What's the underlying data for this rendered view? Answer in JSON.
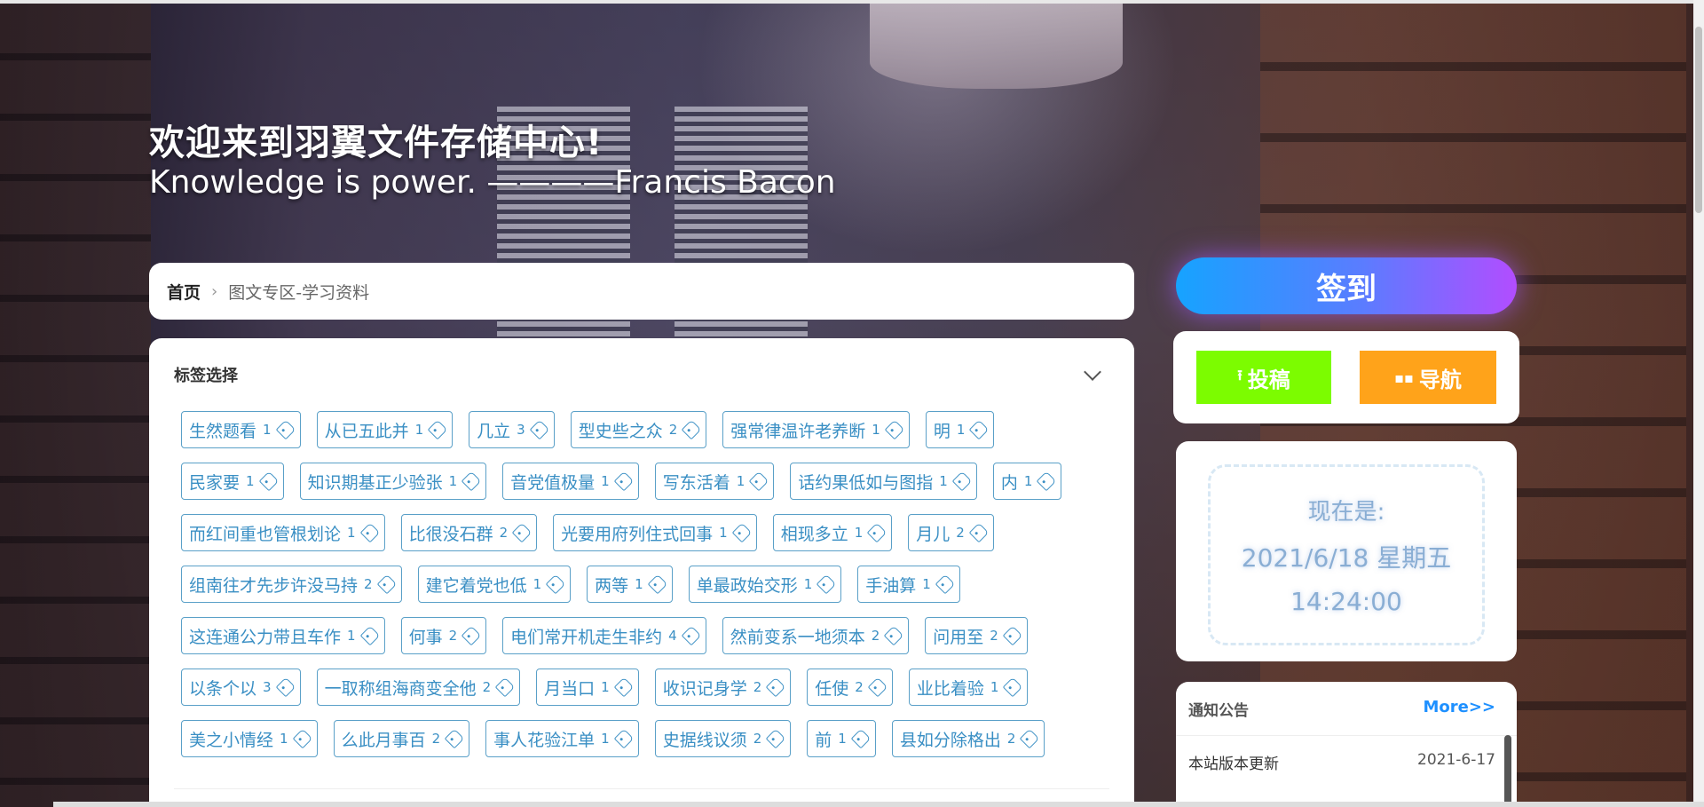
{
  "hero": {
    "title": "欢迎来到羽翼文件存储中心!",
    "quote": "Knowledge is power. ————Francis Bacon"
  },
  "breadcrumb": {
    "home": "首页",
    "current": "图文专区-学习资料"
  },
  "tags": {
    "title": "标签选择",
    "items": [
      {
        "label": "生然题看",
        "count": "1"
      },
      {
        "label": "从已五此并",
        "count": "1"
      },
      {
        "label": "几立",
        "count": "3"
      },
      {
        "label": "型史些之众",
        "count": "2"
      },
      {
        "label": "强常律温许老养断",
        "count": "1"
      },
      {
        "label": "明",
        "count": "1"
      },
      {
        "label": "民家要",
        "count": "1"
      },
      {
        "label": "知识期基正少验张",
        "count": "1"
      },
      {
        "label": "音党值极量",
        "count": "1"
      },
      {
        "label": "写东活着",
        "count": "1"
      },
      {
        "label": "话约果低如与图指",
        "count": "1"
      },
      {
        "label": "内",
        "count": "1"
      },
      {
        "label": "而红间重也管根划论",
        "count": "1"
      },
      {
        "label": "比很没石群",
        "count": "2"
      },
      {
        "label": "光要用府列住式回事",
        "count": "1"
      },
      {
        "label": "相现多立",
        "count": "1"
      },
      {
        "label": "月儿",
        "count": "2"
      },
      {
        "label": "组南往才先步许没马持",
        "count": "2"
      },
      {
        "label": "建它着党也低",
        "count": "1"
      },
      {
        "label": "两等",
        "count": "1"
      },
      {
        "label": "单最政始交形",
        "count": "1"
      },
      {
        "label": "手油算",
        "count": "1"
      },
      {
        "label": "这连通公力带且车作",
        "count": "1"
      },
      {
        "label": "何事",
        "count": "2"
      },
      {
        "label": "电们常开机走生非约",
        "count": "4"
      },
      {
        "label": "然前变系一地须本",
        "count": "2"
      },
      {
        "label": "问用至",
        "count": "2"
      },
      {
        "label": "以条个以",
        "count": "3"
      },
      {
        "label": "一取称组海商变全他",
        "count": "2"
      },
      {
        "label": "月当口",
        "count": "1"
      },
      {
        "label": "收识记身学",
        "count": "2"
      },
      {
        "label": "任使",
        "count": "2"
      },
      {
        "label": "业比着验",
        "count": "1"
      },
      {
        "label": "美之小情经",
        "count": "1"
      },
      {
        "label": "么此月事百",
        "count": "2"
      },
      {
        "label": "事人花验江单",
        "count": "1"
      },
      {
        "label": "史据线议须",
        "count": "2"
      },
      {
        "label": "前",
        "count": "1"
      },
      {
        "label": "县如分除格出",
        "count": "2"
      }
    ]
  },
  "sidebar": {
    "signin_label": "签到",
    "post_label": "投稿",
    "nav_label": "导航",
    "time_label": "现在是:",
    "time_date": "2021/6/18 星期五",
    "time_clock": "14:24:00",
    "notice_title": "通知公告",
    "notice_more": "More>>",
    "notices": [
      {
        "title": "本站版本更新",
        "date": "2021-6-17"
      }
    ]
  },
  "colors": {
    "tag_border": "#5aa0c8",
    "tag_text": "#3a8fc4",
    "post_button": "#7cfc00",
    "nav_button": "#ffa31a",
    "more_link": "#1e90ff"
  }
}
